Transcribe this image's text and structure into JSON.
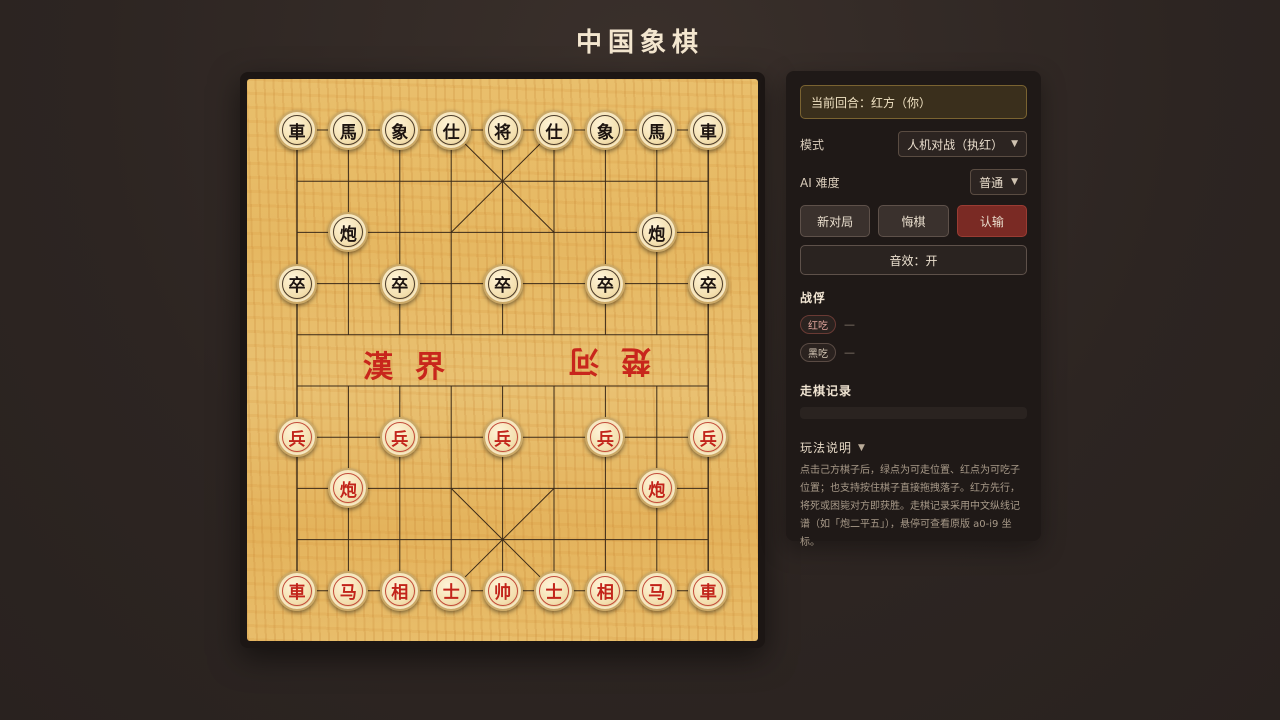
{
  "title": "中国象棋",
  "board": {
    "river_left": "漢界",
    "river_right": "楚河",
    "pieces": [
      {
        "char": "車",
        "side": "black",
        "file": 0,
        "rank": 0
      },
      {
        "char": "馬",
        "side": "black",
        "file": 1,
        "rank": 0
      },
      {
        "char": "象",
        "side": "black",
        "file": 2,
        "rank": 0
      },
      {
        "char": "仕",
        "side": "black",
        "file": 3,
        "rank": 0
      },
      {
        "char": "将",
        "side": "black",
        "file": 4,
        "rank": 0
      },
      {
        "char": "仕",
        "side": "black",
        "file": 5,
        "rank": 0
      },
      {
        "char": "象",
        "side": "black",
        "file": 6,
        "rank": 0
      },
      {
        "char": "馬",
        "side": "black",
        "file": 7,
        "rank": 0
      },
      {
        "char": "車",
        "side": "black",
        "file": 8,
        "rank": 0
      },
      {
        "char": "炮",
        "side": "black",
        "file": 1,
        "rank": 2
      },
      {
        "char": "炮",
        "side": "black",
        "file": 7,
        "rank": 2
      },
      {
        "char": "卒",
        "side": "black",
        "file": 0,
        "rank": 3
      },
      {
        "char": "卒",
        "side": "black",
        "file": 2,
        "rank": 3
      },
      {
        "char": "卒",
        "side": "black",
        "file": 4,
        "rank": 3
      },
      {
        "char": "卒",
        "side": "black",
        "file": 6,
        "rank": 3
      },
      {
        "char": "卒",
        "side": "black",
        "file": 8,
        "rank": 3
      },
      {
        "char": "兵",
        "side": "red",
        "file": 0,
        "rank": 6
      },
      {
        "char": "兵",
        "side": "red",
        "file": 2,
        "rank": 6
      },
      {
        "char": "兵",
        "side": "red",
        "file": 4,
        "rank": 6
      },
      {
        "char": "兵",
        "side": "red",
        "file": 6,
        "rank": 6
      },
      {
        "char": "兵",
        "side": "red",
        "file": 8,
        "rank": 6
      },
      {
        "char": "炮",
        "side": "red",
        "file": 1,
        "rank": 7
      },
      {
        "char": "炮",
        "side": "red",
        "file": 7,
        "rank": 7
      },
      {
        "char": "車",
        "side": "red",
        "file": 0,
        "rank": 9
      },
      {
        "char": "马",
        "side": "red",
        "file": 1,
        "rank": 9
      },
      {
        "char": "相",
        "side": "red",
        "file": 2,
        "rank": 9
      },
      {
        "char": "士",
        "side": "red",
        "file": 3,
        "rank": 9
      },
      {
        "char": "帅",
        "side": "red",
        "file": 4,
        "rank": 9
      },
      {
        "char": "士",
        "side": "red",
        "file": 5,
        "rank": 9
      },
      {
        "char": "相",
        "side": "red",
        "file": 6,
        "rank": 9
      },
      {
        "char": "马",
        "side": "red",
        "file": 7,
        "rank": 9
      },
      {
        "char": "車",
        "side": "red",
        "file": 8,
        "rank": 9
      }
    ]
  },
  "panel": {
    "turn": "当前回合：红方（你）",
    "mode_label": "模式",
    "mode_value": "人机对战（执红）",
    "ai_label": "AI 难度",
    "ai_value": "普通",
    "new_game": "新对局",
    "undo": "悔棋",
    "resign": "认输",
    "sound": "音效：开",
    "captured_title": "战俘",
    "red_captured_label": "红吃",
    "red_captured_value": "—",
    "black_captured_label": "黑吃",
    "black_captured_value": "—",
    "moves_title": "走棋记录",
    "howto_title": "玩法说明",
    "howto_text": "点击己方棋子后，绿点为可走位置、红点为可吃子位置；也支持按住棋子直接拖拽落子。红方先行，将死或困毙对方即获胜。走棋记录采用中文纵线记谱（如「炮二平五」），悬停可查看原版 a0-i9 坐标。"
  },
  "colors": {
    "accent_red": "#c2241a",
    "danger_button": "#7a2a24",
    "board_wood": "#e8bd6a"
  }
}
